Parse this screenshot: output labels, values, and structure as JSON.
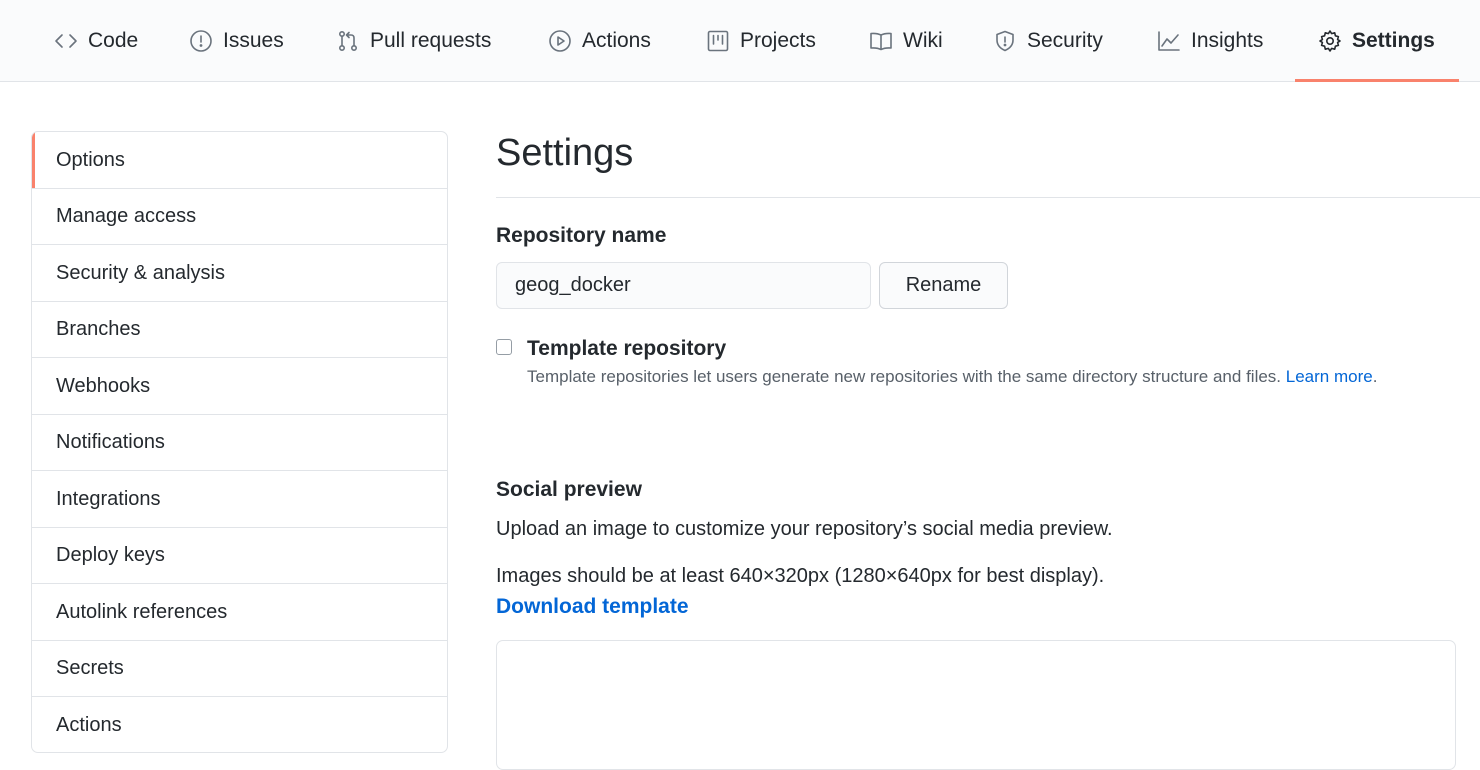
{
  "nav": {
    "tabs": [
      {
        "label": "Code",
        "icon": "code-icon"
      },
      {
        "label": "Issues",
        "icon": "issue-icon"
      },
      {
        "label": "Pull requests",
        "icon": "pull-request-icon"
      },
      {
        "label": "Actions",
        "icon": "play-icon"
      },
      {
        "label": "Projects",
        "icon": "project-icon"
      },
      {
        "label": "Wiki",
        "icon": "book-icon"
      },
      {
        "label": "Security",
        "icon": "shield-icon"
      },
      {
        "label": "Insights",
        "icon": "graph-icon"
      },
      {
        "label": "Settings",
        "icon": "gear-icon"
      }
    ],
    "selected": "Settings",
    "accent_color": "#f9826c"
  },
  "menu": {
    "items": [
      "Options",
      "Manage access",
      "Security & analysis",
      "Branches",
      "Webhooks",
      "Notifications",
      "Integrations",
      "Deploy keys",
      "Autolink references",
      "Secrets",
      "Actions"
    ],
    "selected": "Options"
  },
  "main": {
    "title": "Settings",
    "repo_name_label": "Repository name",
    "repo_name_value": "geog_docker",
    "rename_label": "Rename",
    "template": {
      "label": "Template repository",
      "checked": false,
      "help": "Template repositories let users generate new repositories with the same directory structure and files.",
      "link": "Learn more",
      "period": "."
    },
    "social": {
      "heading": "Social preview",
      "description": "Upload an image to customize your repository’s social media preview.",
      "requirement": "Images should be at least 640×320px (1280×640px for best display).",
      "download_label": "Download template"
    },
    "link_color": "#0366d6"
  }
}
